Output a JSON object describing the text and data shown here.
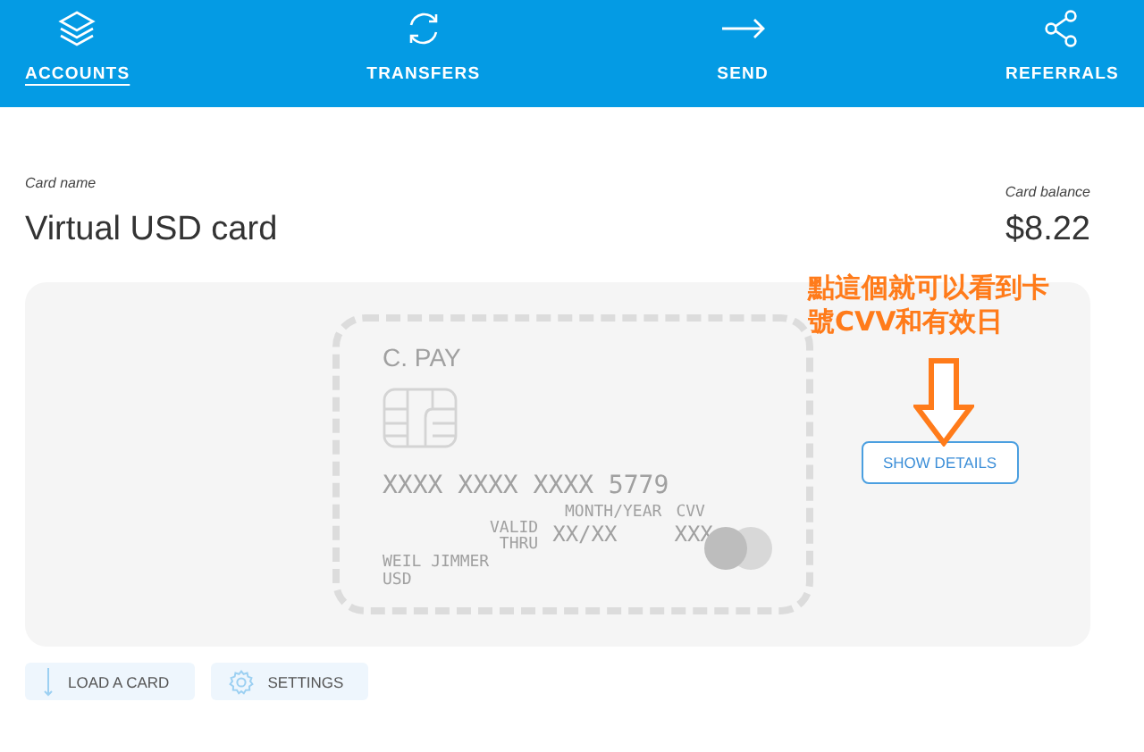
{
  "nav": {
    "tabs": [
      {
        "label": "ACCOUNTS",
        "selected": true
      },
      {
        "label": "TRANSFERS",
        "selected": false
      },
      {
        "label": "SEND",
        "selected": false
      },
      {
        "label": "REFERRALS",
        "selected": false
      }
    ]
  },
  "account": {
    "name_label": "Card name",
    "name": "Virtual USD card",
    "balance_label": "Card balance",
    "balance": "$8.22"
  },
  "virtual_card": {
    "brand": "C. PAY",
    "number": "XXXX XXXX XXXX 5779",
    "expiry_caption": "MONTH/YEAR",
    "cvv_caption": "CVV",
    "valid_thru": [
      "VALID",
      "THRU"
    ],
    "expiry": "XX/XX",
    "cvv": "XXX",
    "holder": "WEIL JIMMER",
    "currency": "USD"
  },
  "show_details_button": "SHOW DETAILS",
  "annotation": {
    "lines": [
      "點這個就可以看到卡",
      "號CVV和有效日"
    ]
  },
  "actions": [
    {
      "label": "LOAD A CARD"
    },
    {
      "label": "SETTINGS"
    }
  ]
}
